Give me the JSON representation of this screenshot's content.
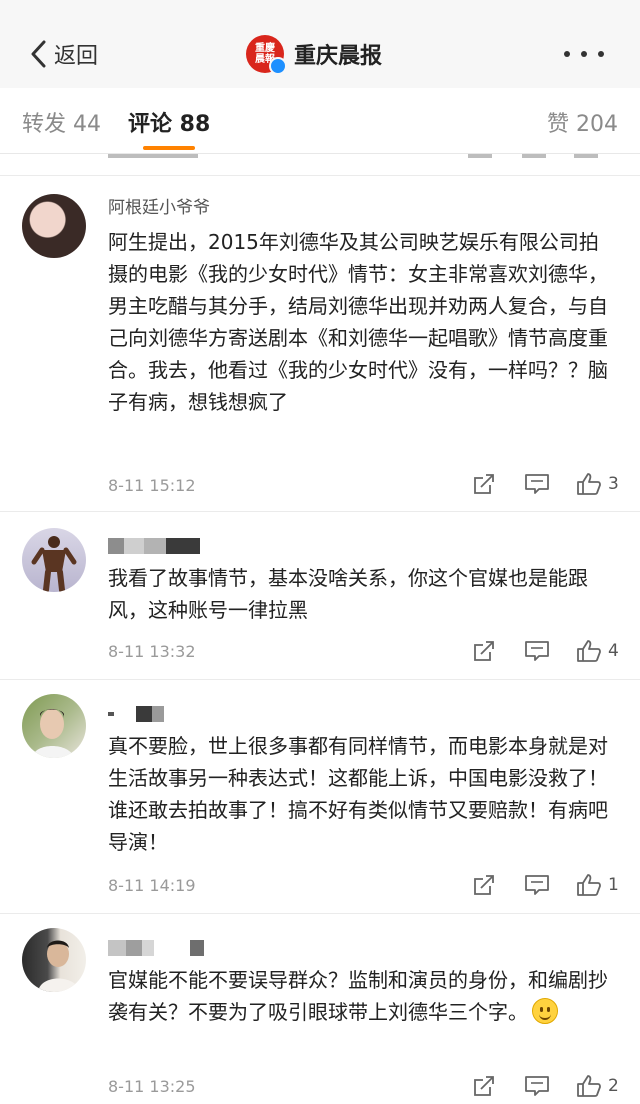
{
  "nav": {
    "back_label": "返回",
    "title": "重庆晨报",
    "avatar_text": "重庆晨报"
  },
  "tabs": {
    "repost": "转发 44",
    "comments": "评论 88",
    "likes": "赞 204",
    "active": "comments",
    "accent_color": "#ff8200"
  },
  "comments": [
    {
      "username": "阿根廷小爷爷",
      "content": "阿生提出，2015年刘德华及其公司映艺娱乐有限公司拍摄的电影《我的少女时代》情节：女主非常喜欢刘德华，男主吃醋与其分手，结局刘德华出现并劝两人复合，与自己向刘德华方寄送剧本《和刘德华一起唱歌》情节高度重合。我去，他看过《我的少女时代》没有，一样吗？？脑子有病，想钱想疯了",
      "time": "8-11 15:12",
      "likes": "3"
    },
    {
      "username": "",
      "content": "我看了故事情节，基本没啥关系，你这个官媒也是能跟风，这种账号一律拉黑",
      "time": "8-11 13:32",
      "likes": "4"
    },
    {
      "username": "",
      "content": "真不要脸，世上很多事都有同样情节，而电影本身就是对生活故事另一种表达式！这都能上诉，中国电影没救了！谁还敢去拍故事了！搞不好有类似情节又要赔款！有病吧导演！",
      "time": "8-11 14:19",
      "likes": "1"
    },
    {
      "username": "",
      "content": "官媒能不能不要误导群众？监制和演员的身份，和编剧抄袭有关？不要为了吸引眼球带上刘德华三个字。",
      "time": "8-11 13:25",
      "likes": "2"
    }
  ],
  "icons": {
    "back": "chevron-left-icon",
    "more": "more-dots-icon",
    "share": "share-icon",
    "reply": "comment-icon",
    "like": "thumbs-up-icon",
    "emoji": "smile-emoji-icon"
  }
}
